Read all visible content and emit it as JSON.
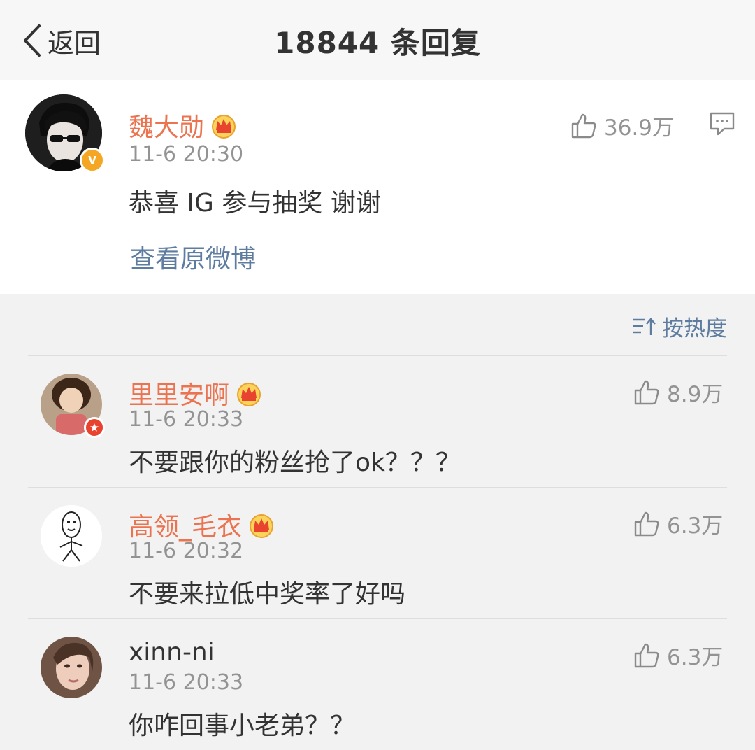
{
  "nav": {
    "back_label": "返回",
    "title": "18844 条回复"
  },
  "post": {
    "username": "魏大勋",
    "time": "11-6 20:30",
    "text": "恭喜 IG 参与抽奖 谢谢",
    "likes": "36.9万",
    "view_original": "查看原微博",
    "icons": [
      "avatar",
      "verified-v-icon",
      "vip-crown-icon",
      "like-icon",
      "comment-icon"
    ]
  },
  "sort": {
    "label": "按热度",
    "icon": "sort-icon"
  },
  "comments": [
    {
      "username": "里里安啊",
      "time": "11-6 20:33",
      "text": "不要跟你的粉丝抢了ok？？？",
      "likes": "8.9万",
      "vip": true
    },
    {
      "username": "高领_毛衣",
      "time": "11-6 20:32",
      "text": "不要来拉低中奖率了好吗",
      "likes": "6.3万",
      "vip": true
    },
    {
      "username": "xinn-ni",
      "time": "11-6 20:33",
      "text": "你咋回事小老弟？？",
      "likes": "6.3万",
      "vip": false
    }
  ],
  "colors": {
    "username_vip": "#eb7350",
    "link": "#5d7c9f",
    "meta": "#939393",
    "text": "#333333",
    "background": "#f2f2f2"
  }
}
